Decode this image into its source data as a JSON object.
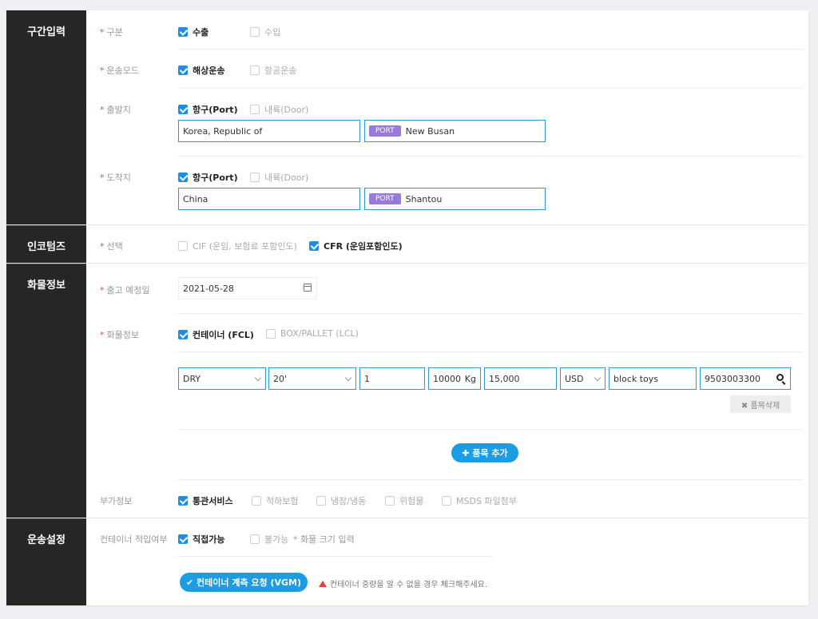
{
  "sections": {
    "route": "구간입력",
    "incoterms": "인코텀즈",
    "cargo": "화물정보",
    "transport": "운송설정"
  },
  "route": {
    "type": {
      "label": "구분",
      "options": [
        {
          "label": "수출",
          "checked": true
        },
        {
          "label": "수입",
          "checked": false
        }
      ]
    },
    "mode": {
      "label": "운송모드",
      "options": [
        {
          "label": "해상운송",
          "checked": true
        },
        {
          "label": "항공운송",
          "checked": false
        }
      ]
    },
    "origin": {
      "label": "출발지",
      "options": [
        {
          "label": "항구(Port)",
          "checked": true
        },
        {
          "label": "내륙(Door)",
          "checked": false
        }
      ],
      "country": "Korea, Republic of",
      "port_tag": "PORT",
      "port": "New Busan"
    },
    "destination": {
      "label": "도착지",
      "options": [
        {
          "label": "항구(Port)",
          "checked": true
        },
        {
          "label": "내륙(Door)",
          "checked": false
        }
      ],
      "country": "China",
      "port_tag": "PORT",
      "port": "Shantou"
    }
  },
  "incoterms": {
    "label": "선택",
    "options": [
      {
        "label": "CIF (운임, 보험료 포함인도)",
        "checked": false
      },
      {
        "label": "CFR (운임포함인도)",
        "checked": true
      }
    ]
  },
  "cargo": {
    "ship_date": {
      "label": "출고 예정일",
      "value": "2021-05-28"
    },
    "cargo_info": {
      "label": "화물정보",
      "options": [
        {
          "label": "컨테이너 (FCL)",
          "checked": true
        },
        {
          "label": "BOX/PALLET (LCL)",
          "checked": false
        }
      ]
    },
    "item": {
      "container_type": "DRY",
      "container_size": "20'",
      "quantity": "1",
      "weight": "10000",
      "weight_unit": "Kg",
      "amount": "15,000",
      "currency": "USD",
      "description": "block toys",
      "hs_code": "9503003300"
    },
    "delete_item": "✖ 품목삭제",
    "add_item": "✚ 품목 추가",
    "extra": {
      "label": "부가정보",
      "options": [
        {
          "label": "통관서비스",
          "checked": true
        },
        {
          "label": "적하보험",
          "checked": false
        },
        {
          "label": "냉장/냉동",
          "checked": false
        },
        {
          "label": "위험물",
          "checked": false
        },
        {
          "label": "MSDS 파일첨부",
          "checked": false
        }
      ]
    }
  },
  "transport": {
    "container_load": {
      "label": "컨테이너 적입여부",
      "options": [
        {
          "label": "직접가능",
          "checked": true
        },
        {
          "label": "불가능",
          "checked": false
        }
      ],
      "note": "* 화물 크기 입력"
    },
    "vgm_button": "✔ 컨테이너 계측 요청 (VGM)",
    "vgm_warning": "컨테이너 중량을 알 수 없을 경우 체크해주세요."
  },
  "colors": {
    "accent": "#1c8ee6",
    "port_tag": "#9a7ad8",
    "sidebar": "#262626",
    "warning": "#e04040"
  }
}
